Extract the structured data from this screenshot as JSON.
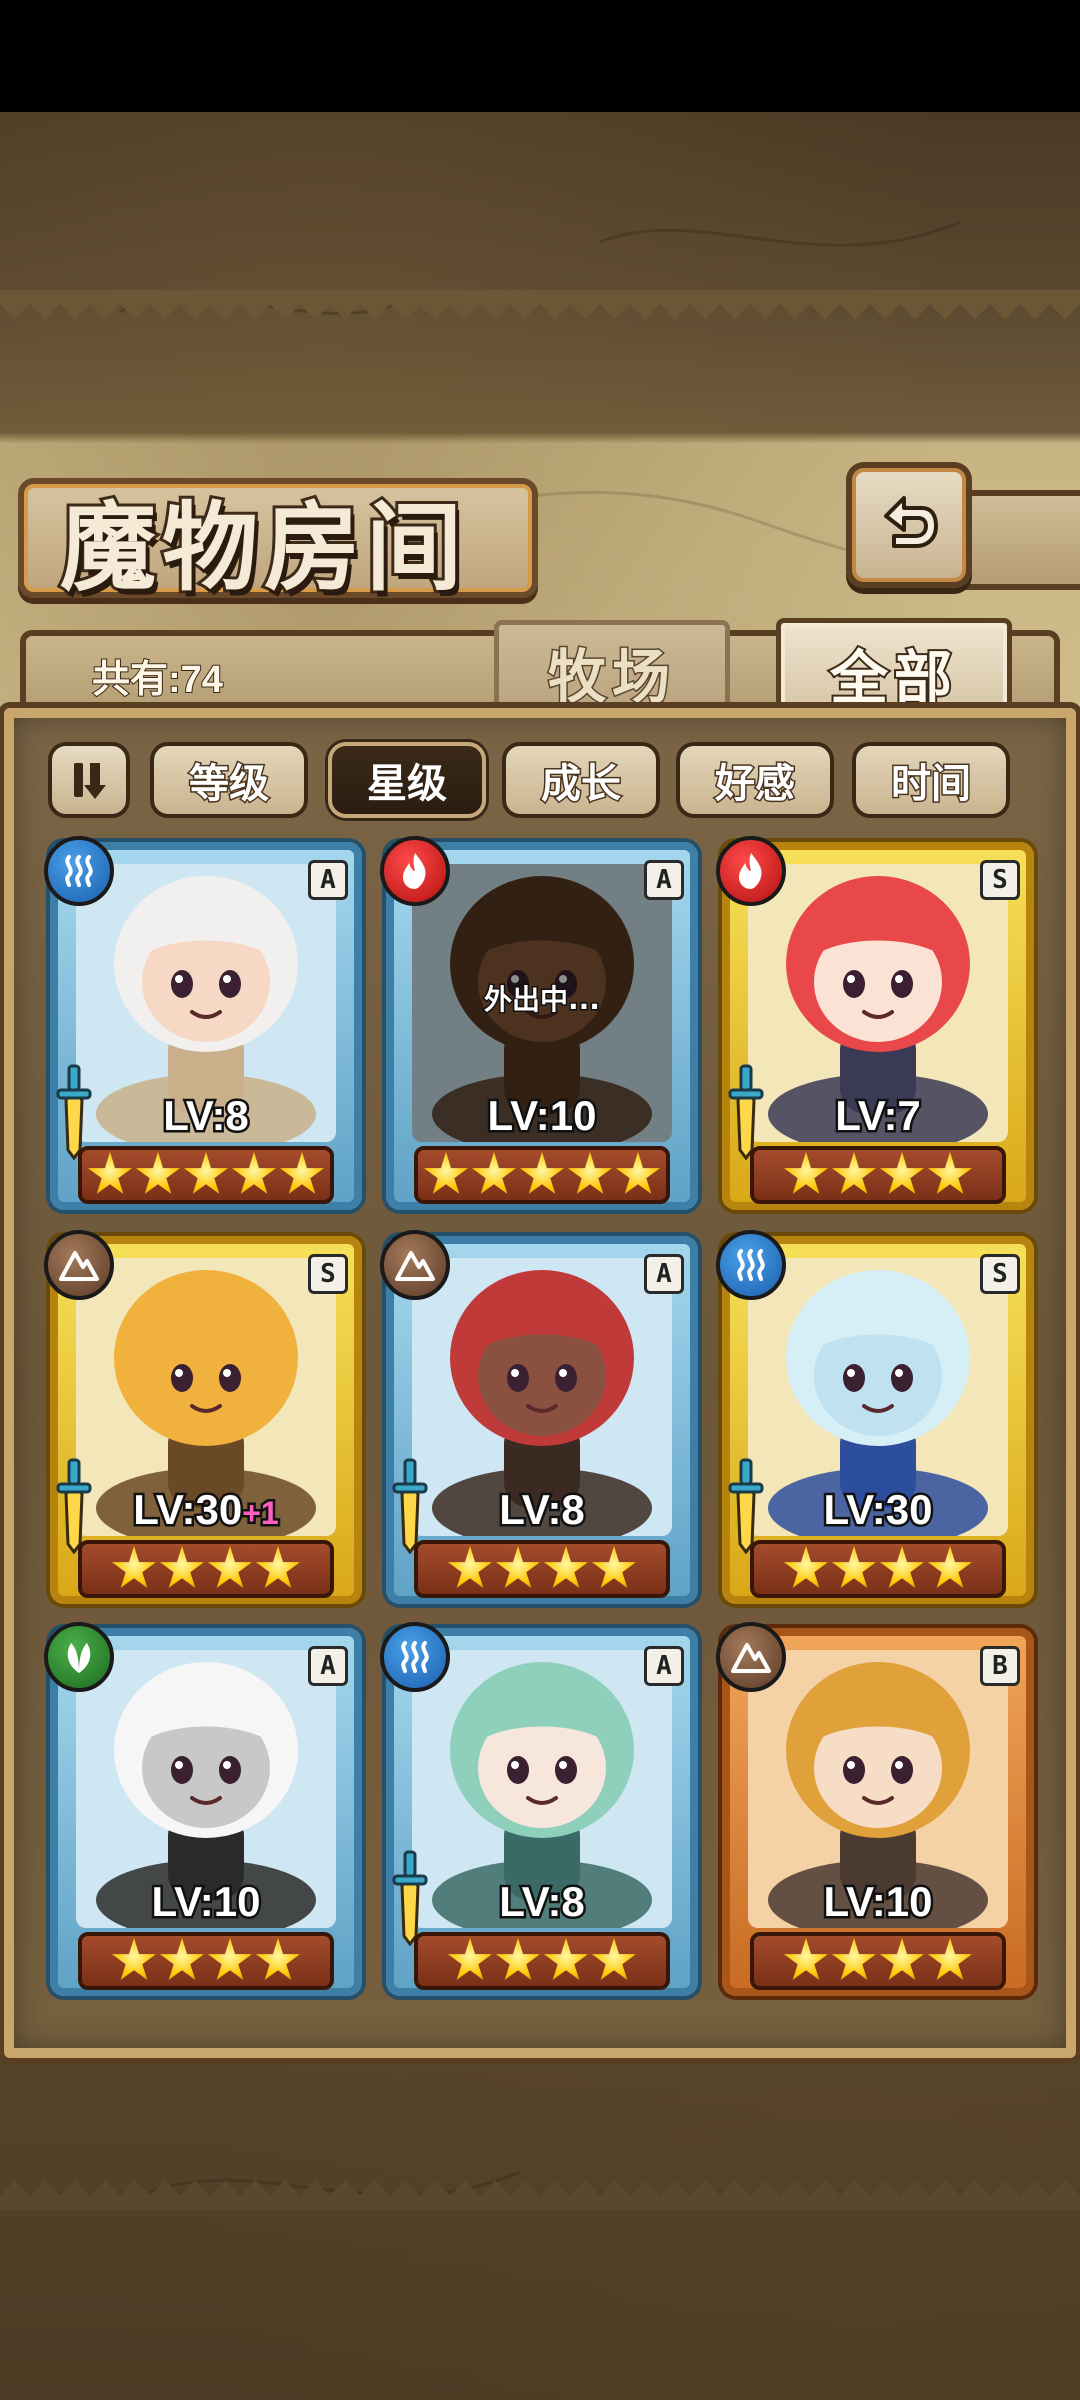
{
  "page": {
    "title": "魔物房间",
    "count_label": "共有:74"
  },
  "tabs": {
    "ranch": "牧场",
    "all": "全部",
    "active": "all"
  },
  "sort": {
    "toggle_icon": "sort-toggle-icon",
    "options": [
      "等级",
      "星级",
      "成长",
      "好感",
      "时间"
    ],
    "active": "星级"
  },
  "monsters": [
    {
      "element": "water",
      "rank": "A",
      "level": "LV:8",
      "plus": "",
      "stars": 5,
      "frame": "blue",
      "status": "",
      "hair": "#f2f0ee",
      "skin": "#f6d8c4",
      "accent": "#c9b08a"
    },
    {
      "element": "fire",
      "rank": "A",
      "level": "LV:10",
      "plus": "",
      "stars": 5,
      "frame": "blue",
      "status": "外出中...",
      "hair": "#5a3a22",
      "skin": "#8a5a38",
      "accent": "#5a3a22"
    },
    {
      "element": "fire",
      "rank": "S",
      "level": "LV:7",
      "plus": "",
      "stars": 4,
      "frame": "gold",
      "status": "",
      "hair": "#e8484a",
      "skin": "#fbe2d4",
      "accent": "#3a3a55"
    },
    {
      "element": "earth",
      "rank": "S",
      "level": "LV:30",
      "plus": "+1",
      "stars": 4,
      "frame": "gold",
      "status": "",
      "hair": "#f0b23c",
      "skin": "#f0b23c",
      "accent": "#6a4a26"
    },
    {
      "element": "earth",
      "rank": "A",
      "level": "LV:8",
      "plus": "",
      "stars": 4,
      "frame": "blue",
      "status": "",
      "hair": "#c13a3a",
      "skin": "#8a5040",
      "accent": "#3a2a22"
    },
    {
      "element": "water",
      "rank": "S",
      "level": "LV:30",
      "plus": "",
      "stars": 4,
      "frame": "gold",
      "status": "",
      "hair": "#d6eef6",
      "skin": "#bfe1f0",
      "accent": "#2c4e9c"
    },
    {
      "element": "wind",
      "rank": "A",
      "level": "LV:10",
      "plus": "",
      "stars": 4,
      "frame": "blue",
      "status": "",
      "hair": "#f6f6f6",
      "skin": "#c8c8c8",
      "accent": "#2a2a2a"
    },
    {
      "element": "water",
      "rank": "A",
      "level": "LV:8",
      "plus": "",
      "stars": 4,
      "frame": "blue",
      "status": "",
      "hair": "#8fd0bc",
      "skin": "#f6e6dc",
      "accent": "#3b6a66"
    },
    {
      "element": "earth",
      "rank": "B",
      "level": "LV:10",
      "plus": "",
      "stars": 4,
      "frame": "bronze",
      "status": "",
      "hair": "#e0a03a",
      "skin": "#f7dcc6",
      "accent": "#4a3a30"
    }
  ]
}
